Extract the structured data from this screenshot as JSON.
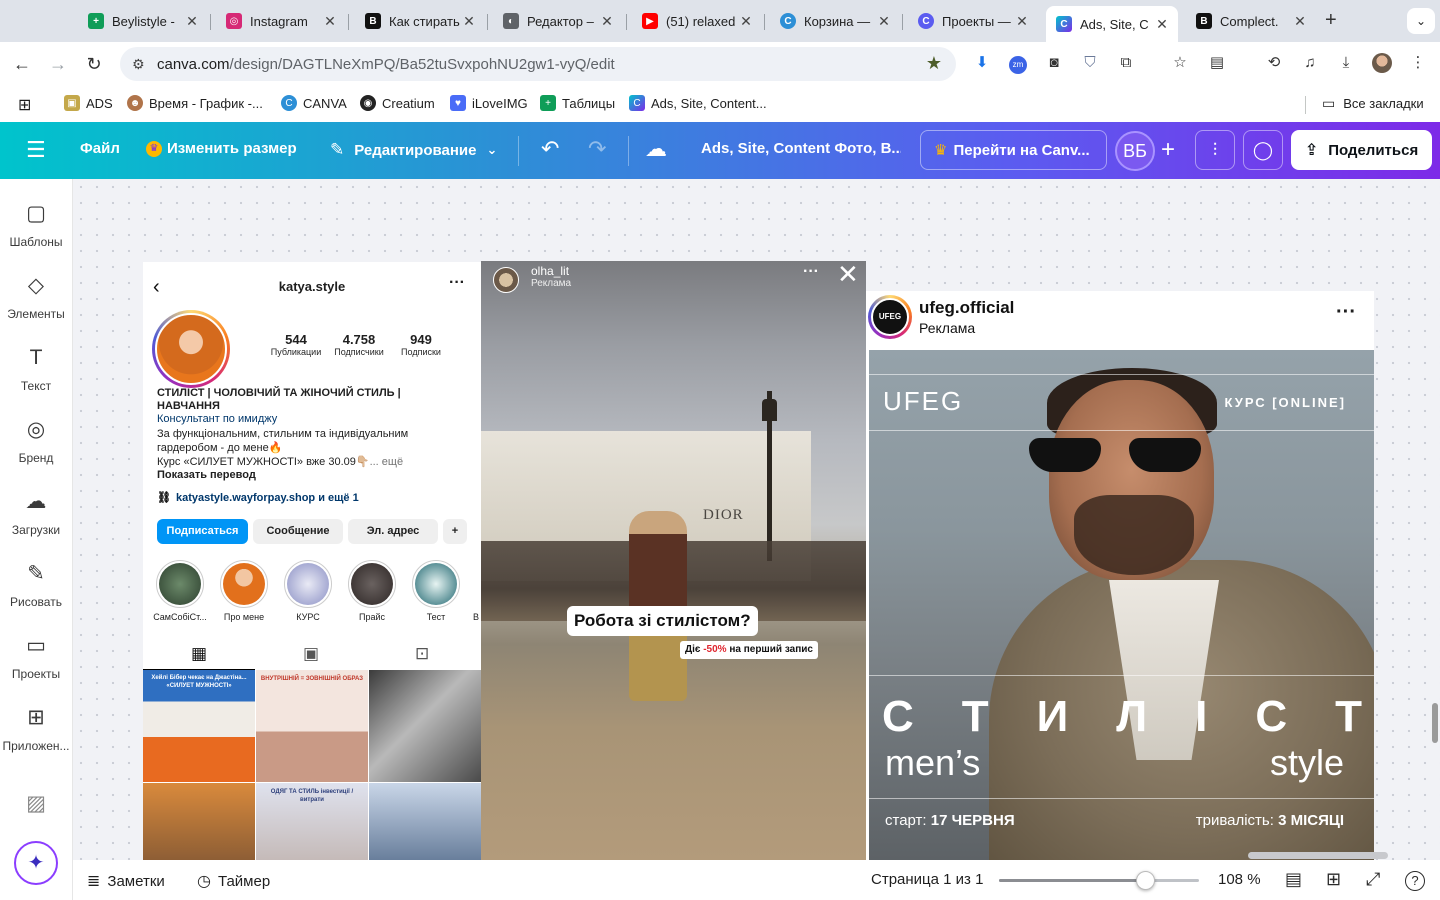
{
  "browser": {
    "tabs": [
      {
        "title": "Beylistyle -",
        "color": "#0f9d58",
        "glyph": "+"
      },
      {
        "title": "Instagram",
        "color": "#d62976",
        "glyph": "◎"
      },
      {
        "title": "Как стирать",
        "color": "#111111",
        "glyph": "B"
      },
      {
        "title": "Редактор –",
        "color": "#5f6368",
        "glyph": "◐"
      },
      {
        "title": "(51) relaxed",
        "color": "#ff0000",
        "glyph": "▶"
      },
      {
        "title": "Корзина —",
        "color": "#2d8fd6",
        "glyph": "C"
      },
      {
        "title": "Проекты —",
        "color": "#5b5cf0",
        "glyph": "C"
      },
      {
        "title": "Ads, Site, C",
        "color": "#7d2ae8",
        "glyph": "C"
      },
      {
        "title": "Complect.",
        "color": "#111111",
        "glyph": "B"
      }
    ],
    "active_tab_index": 7,
    "url_domain": "canva.com",
    "url_path": "/design/DAGTLNeXmPQ/Ba52tuSvxpohNU2gw1-vyQ/edit",
    "bookmarks": [
      {
        "label": "ADS",
        "color": "#c4a84a",
        "glyph": "▣"
      },
      {
        "label": "Время - График -...",
        "color": "#b0744a",
        "glyph": "☻"
      },
      {
        "label": "CANVA",
        "color": "#2d8fd6",
        "glyph": "C"
      },
      {
        "label": "Creatium",
        "color": "#222222",
        "glyph": "◉"
      },
      {
        "label": "iLoveIMG",
        "color": "#4a6cf7",
        "glyph": "♥"
      },
      {
        "label": "Таблицы",
        "color": "#0f9d58",
        "glyph": "+"
      },
      {
        "label": "Ads, Site, Content...",
        "color": "#7d2ae8",
        "glyph": "C"
      }
    ],
    "all_bookmarks_label": "Все закладки"
  },
  "canva": {
    "menu_file": "Файл",
    "resize": "Изменить размер",
    "editing": "Редактирование",
    "design_title": "Ads, Site, Content Фото, В...",
    "go_premium": "Перейти на Canv...",
    "user_initials": "ВБ",
    "share": "Поделиться",
    "sidebar": [
      {
        "label": "Шаблоны",
        "icon": "▢"
      },
      {
        "label": "Элементы",
        "icon": "◇"
      },
      {
        "label": "Текст",
        "icon": "T"
      },
      {
        "label": "Бренд",
        "icon": "◎"
      },
      {
        "label": "Загрузки",
        "icon": "☁"
      },
      {
        "label": "Рисовать",
        "icon": "✎"
      },
      {
        "label": "Проекты",
        "icon": "▭"
      },
      {
        "label": "Приложен...",
        "icon": "⊞"
      }
    ],
    "footer": {
      "notes": "Заметки",
      "timer": "Таймер",
      "page": "Страница 1 из 1",
      "zoom": "108 %",
      "zoom_fraction": 0.73
    }
  },
  "instagram_profile": {
    "username": "katya.style",
    "stats": [
      {
        "value": "544",
        "label": "Публикации"
      },
      {
        "value": "4.758",
        "label": "Подписчики"
      },
      {
        "value": "949",
        "label": "Подписки"
      }
    ],
    "name": "СТИЛІСТ | ЧОЛОВІЧИЙ ТА ЖІНОЧИЙ СТИЛЬ | НАВЧАННЯ",
    "category": "Консультант по имиджу",
    "bio_line1": "За функціональним, стильним та індивідуальним",
    "bio_line2": "гардеробом - до мене🔥",
    "bio_line3": "Курс «СИЛУЕТ МУЖНОСТІ» вже 30.09👇🏼",
    "bio_more": "... ещё",
    "show_translation": "Показать перевод",
    "link": "katyastyle.wayforpay.shop и ещё 1",
    "buttons": {
      "follow": "Подписаться",
      "message": "Сообщение",
      "email": "Эл. адрес"
    },
    "highlights": [
      "СамСобіСт...",
      "Про мене",
      "КУРС",
      "Прайс",
      "Тест"
    ],
    "post_captions": [
      "Хейлі Бібер чекає на Джастіна... «СИЛУЕТ МУЖНОСТІ»",
      "ВНУТРІШНІЙ = ЗОВНІШНІЙ ОБРАЗ",
      "",
      "",
      "ОДЯГ ТА СТИЛЬ інвестиції / витрати",
      ""
    ]
  },
  "story": {
    "username": "olha_lit",
    "sponsored": "Реклама",
    "sign_text": "DIOR",
    "question": "Робота зі стилістом?",
    "promo_prefix": "Діє ",
    "promo_discount": "-50%",
    "promo_suffix": " на перший запис"
  },
  "ad_post": {
    "username": "ufeg.official",
    "sponsored": "Реклама",
    "logo_text": "UFEG",
    "brand": "UFEG",
    "course_tag": "КУРС  [ONLINE]",
    "headline_letters": [
      "С",
      "Т",
      "И",
      "Л",
      "І",
      "С",
      "Т"
    ],
    "mens": "men’s",
    "style": "style",
    "start_label": "старт: ",
    "start_value": "17 ЧЕРВНЯ",
    "duration_label": "тривалість: ",
    "duration_value": "3 МІСЯЦІ"
  }
}
